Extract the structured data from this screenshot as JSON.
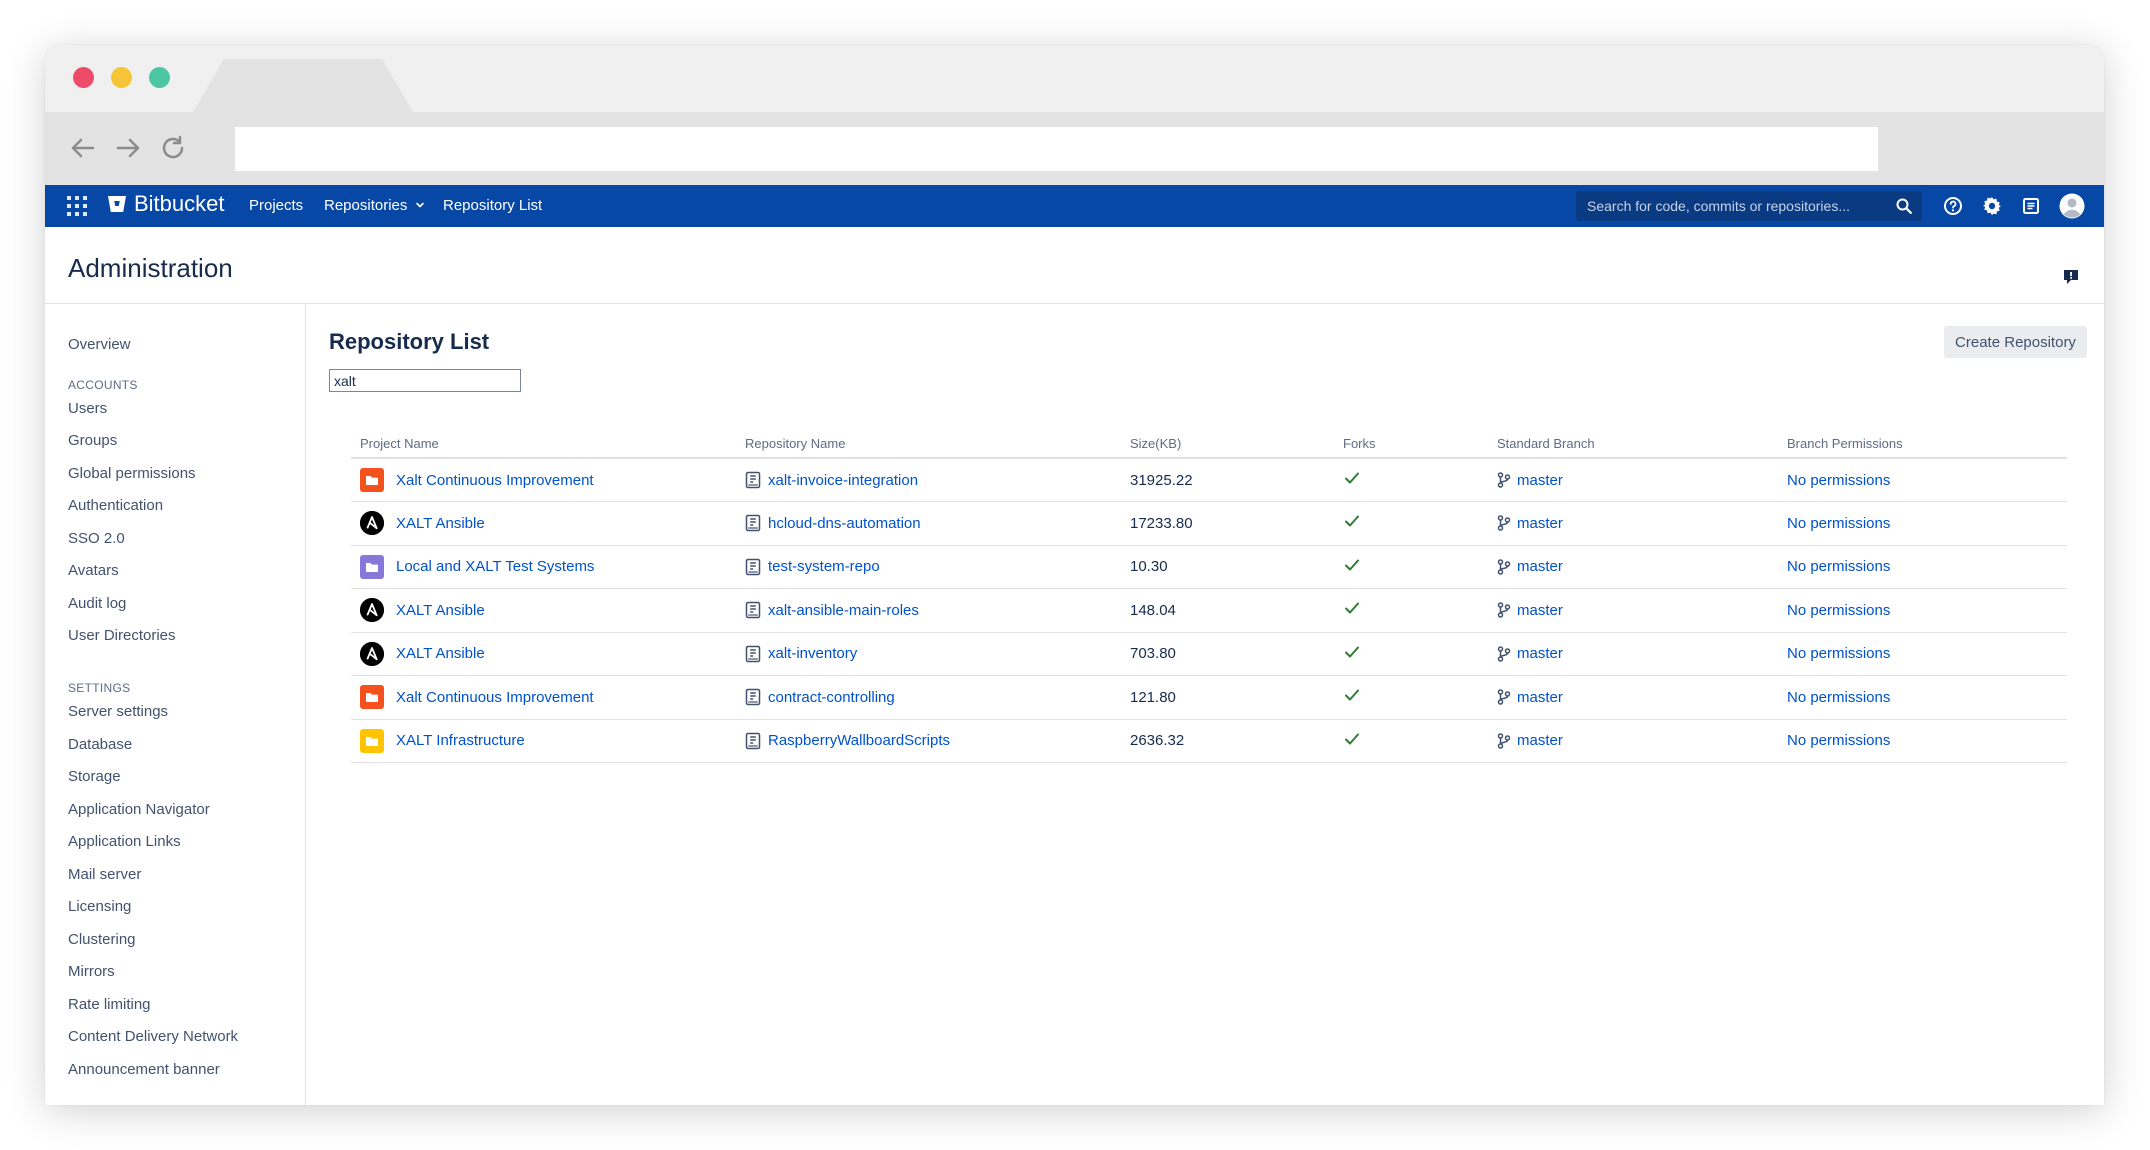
{
  "navbar": {
    "brand": "Bitbucket",
    "links": [
      "Projects",
      "Repositories",
      "Repository List"
    ],
    "search_placeholder": "Search for code, commits or repositories..."
  },
  "page": {
    "header_title": "Administration",
    "main_title": "Repository List",
    "filter_value": "xalt",
    "create_button": "Create Repository"
  },
  "sidebar": {
    "overview": "Overview",
    "accounts_heading": "ACCOUNTS",
    "accounts": [
      "Users",
      "Groups",
      "Global permissions",
      "Authentication",
      "SSO 2.0",
      "Avatars",
      "Audit log",
      "User Directories"
    ],
    "settings_heading": "SETTINGS",
    "settings": [
      "Server settings",
      "Database",
      "Storage",
      "Application Navigator",
      "Application Links",
      "Mail server",
      "Licensing",
      "Clustering",
      "Mirrors",
      "Rate limiting",
      "Content Delivery Network",
      "Announcement banner"
    ]
  },
  "table": {
    "headers": [
      "Project Name",
      "Repository Name",
      "Size(KB)",
      "Forks",
      "Standard Branch",
      "Branch Permissions"
    ],
    "rows": [
      {
        "project": "Xalt Continuous Improvement",
        "avatar": "folder-icon",
        "avatar_color": "#f4511e",
        "repo": "xalt-invoice-integration",
        "size": "31925.22",
        "forks": "check-icon",
        "branch": "master",
        "permissions": "No permissions"
      },
      {
        "project": "XALT Ansible",
        "avatar": "ansible-icon",
        "avatar_color": "#000000",
        "repo": "hcloud-dns-automation",
        "size": "17233.80",
        "forks": "check-icon",
        "branch": "master",
        "permissions": "No permissions"
      },
      {
        "project": "Local and XALT Test Systems",
        "avatar": "folder-icon",
        "avatar_color": "#8777d9",
        "repo": "test-system-repo",
        "size": "10.30",
        "forks": "check-icon",
        "branch": "master",
        "permissions": "No permissions"
      },
      {
        "project": "XALT Ansible",
        "avatar": "ansible-icon",
        "avatar_color": "#000000",
        "repo": "xalt-ansible-main-roles",
        "size": "148.04",
        "forks": "check-icon",
        "branch": "master",
        "permissions": "No permissions"
      },
      {
        "project": "XALT Ansible",
        "avatar": "ansible-icon",
        "avatar_color": "#000000",
        "repo": "xalt-inventory",
        "size": "703.80",
        "forks": "check-icon",
        "branch": "master",
        "permissions": "No permissions"
      },
      {
        "project": "Xalt Continuous Improvement",
        "avatar": "folder-icon",
        "avatar_color": "#f4511e",
        "repo": "contract-controlling",
        "size": "121.80",
        "forks": "check-icon",
        "branch": "master",
        "permissions": "No permissions"
      },
      {
        "project": "XALT Infrastructure",
        "avatar": "folder-icon",
        "avatar_color": "#ffc400",
        "repo": "RaspberryWallboardScripts",
        "size": "2636.32",
        "forks": "check-icon",
        "branch": "master",
        "permissions": "No permissions"
      }
    ]
  },
  "colors": {
    "nav_bg": "#0747a6",
    "link": "#0052cc",
    "check": "#36b37e"
  }
}
